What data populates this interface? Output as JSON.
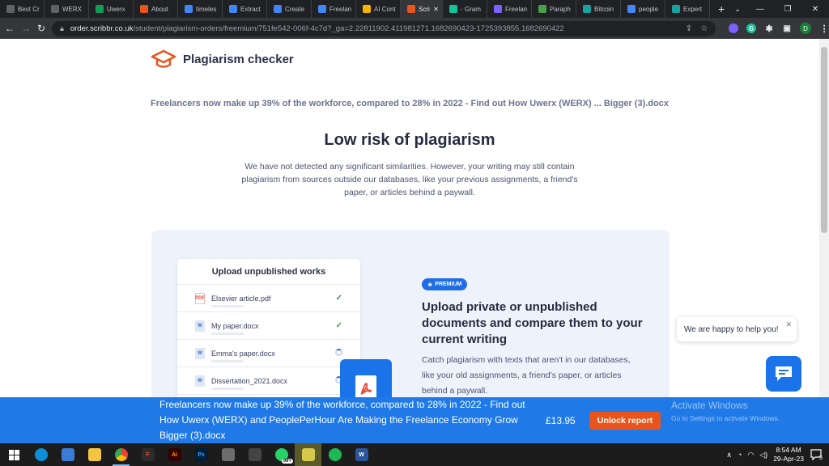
{
  "browser": {
    "tabs": [
      {
        "label": "Best Cr",
        "color": "#5f6368"
      },
      {
        "label": "WERX",
        "color": "#5f6368"
      },
      {
        "label": "Uwerx",
        "color": "#0f9d58"
      },
      {
        "label": "About",
        "color": "#e8541b"
      },
      {
        "label": "timeles",
        "color": "#4285f4"
      },
      {
        "label": "Extract",
        "color": "#4285f4"
      },
      {
        "label": "Create",
        "color": "#4285f4"
      },
      {
        "label": "Freelan",
        "color": "#4285f4"
      },
      {
        "label": "AI Cont",
        "color": "#f4b400"
      },
      {
        "label": "Scri",
        "color": "#e8541b",
        "active": true
      },
      {
        "label": "- Gram",
        "color": "#15c39a"
      },
      {
        "label": "Freelan",
        "color": "#7b61ff"
      },
      {
        "label": "Paraph",
        "color": "#499f4d"
      },
      {
        "label": "Bitcoin",
        "color": "#1aa1a1"
      },
      {
        "label": "people",
        "color": "#4285f4"
      },
      {
        "label": "Expert",
        "color": "#1aa1a1"
      }
    ],
    "url_domain": "order.scribbr.co.uk",
    "url_path": "/student/plagiarism-orders/freemium/751fe542-006f-4c7d?_ga=2.22811902.411981271.1682690423-1725393855.1682690422",
    "profile_initial": "D"
  },
  "page": {
    "logo_text": "Plagiarism checker",
    "doc_name": "Freelancers now make up 39% of the workforce, compared to 28% in 2022 - Find out How Uwerx (WERX) ... Bigger (3).docx",
    "risk_title": "Low risk of plagiarism",
    "risk_desc": "We have not detected any significant similarities. However, your writing may still contain plagiarism from sources outside our databases, like your previous assignments, a friend's paper, or articles behind a paywall.",
    "upload_card": {
      "title": "Upload unpublished works",
      "files": [
        {
          "name": "Elsevier article.pdf",
          "type": "PDF",
          "status": "done"
        },
        {
          "name": "My paper.docx",
          "type": "W",
          "status": "done"
        },
        {
          "name": "Emma's paper.docx",
          "type": "W",
          "status": "loading"
        },
        {
          "name": "Dissertation_2021.docx",
          "type": "W",
          "status": "loading"
        }
      ]
    },
    "premium_label": "PREMIUM",
    "promo_title": "Upload private or unpublished documents and compare them to your current writing",
    "promo_desc": "Catch plagiarism with texts that aren't in our databases, like your old assignments, a friend's paper, or articles behind a paywall.",
    "chat_message": "We are happy to help you!"
  },
  "unlock_bar": {
    "doc_title": "Freelancers now make up 39% of the workforce, compared to 28% in 2022 - Find out How Uwerx (WERX) and PeoplePerHour Are Making the Freelance Economy Grow Bigger (3).docx",
    "price": "£13.95",
    "button_label": "Unlock report"
  },
  "watermark": {
    "title": "Activate Windows",
    "subtitle": "Go to Settings to activate Windows."
  },
  "taskbar": {
    "time": "8:54 AM",
    "date": "29-Apr-23",
    "notification_count": "5",
    "whatsapp_badge": "99+"
  },
  "colors": {
    "accent": "#1f7ae8",
    "unlock_button": "#e8541b",
    "logo": "#e8541b"
  }
}
